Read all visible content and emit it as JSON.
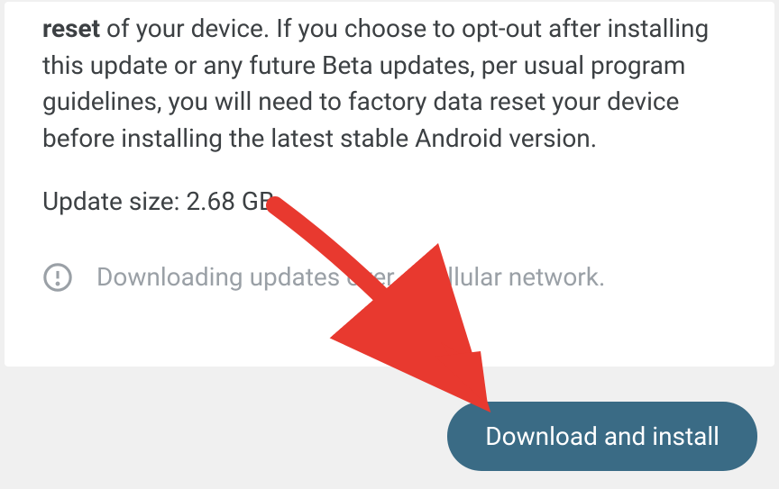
{
  "description": {
    "bold_word": "reset",
    "rest": " of your device. If you choose to opt-out after installing this update or any future Beta updates, per usual program guidelines, you will need to factory data reset your device before installing the latest stable Android version."
  },
  "update_size_line": "Update size: 2.68 GB",
  "warning_text": "Downloading updates over a cellular network.",
  "button_label": "Download and install"
}
